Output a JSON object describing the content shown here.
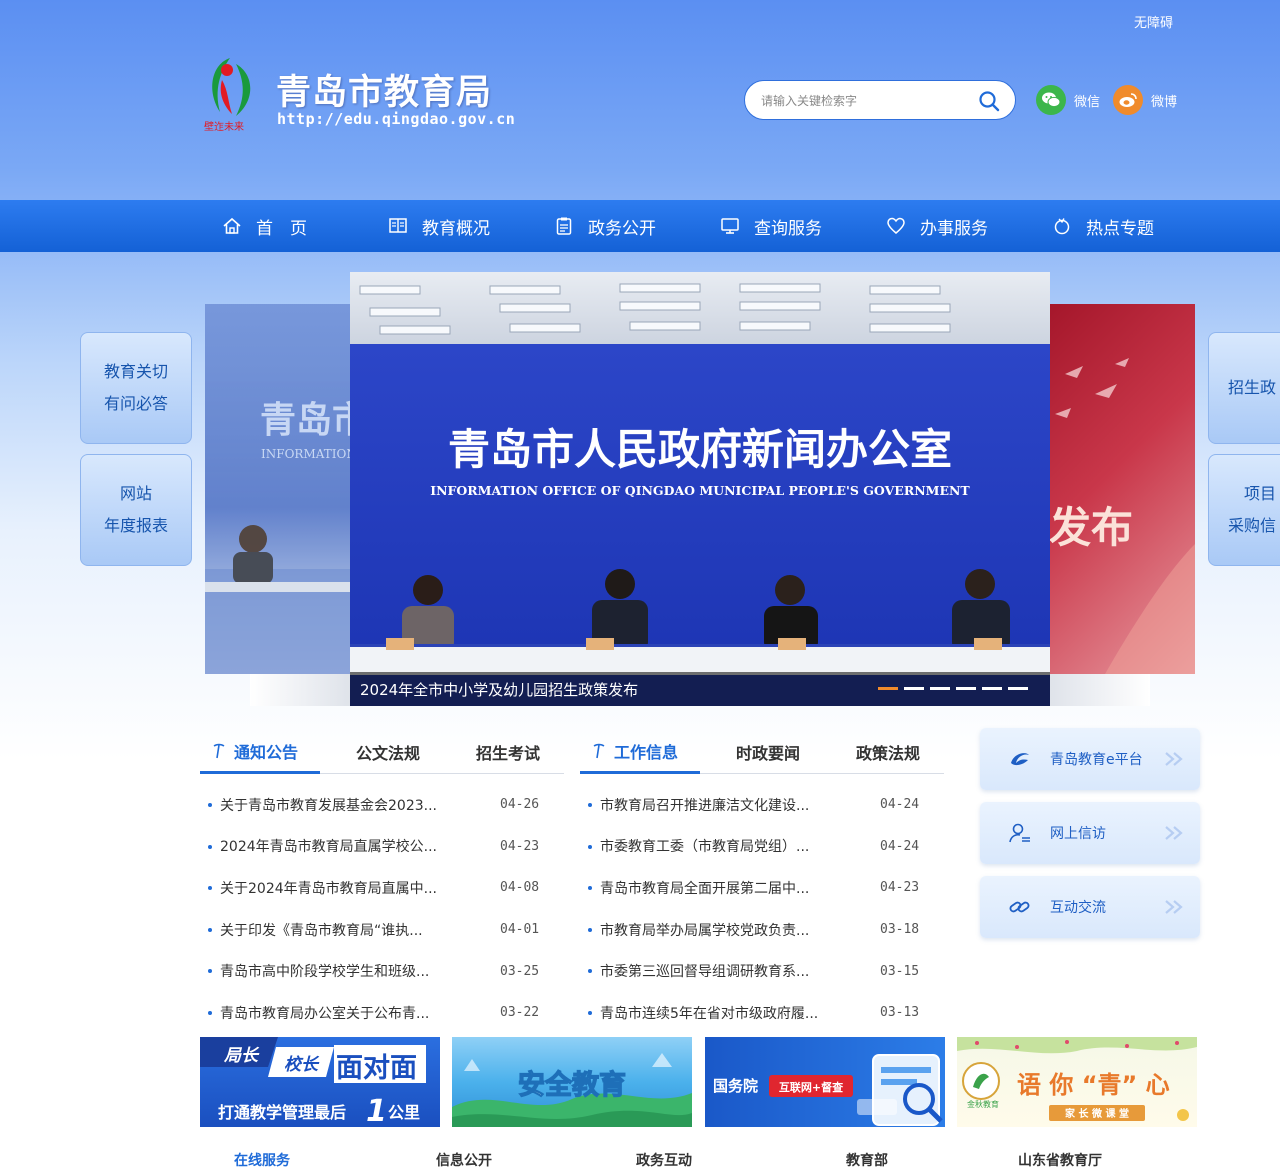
{
  "header": {
    "accessibility": "无障碍",
    "site_title": "青岛市教育局",
    "site_url": "http://edu.qingdao.gov.cn",
    "emblem_caption": "壁迮未来",
    "search_placeholder": "请输入关键检索字",
    "social": [
      {
        "name": "wechat-icon",
        "label": "微信",
        "color": "#3cb64b"
      },
      {
        "name": "weibo-icon",
        "label": "微博",
        "color": "#f08b2c"
      }
    ]
  },
  "nav": {
    "items": [
      {
        "label": "首　页",
        "icon": "home-icon"
      },
      {
        "label": "教育概况",
        "icon": "overview-icon"
      },
      {
        "label": "政务公开",
        "icon": "clipboard-icon"
      },
      {
        "label": "查询服务",
        "icon": "monitor-icon"
      },
      {
        "label": "办事服务",
        "icon": "heart-icon"
      },
      {
        "label": "热点专题",
        "icon": "flame-icon"
      }
    ]
  },
  "side_left": [
    {
      "line1": "教育关切",
      "line2": "有问必答"
    },
    {
      "line1": "网站",
      "line2": "年度报表"
    }
  ],
  "side_right": [
    {
      "line1": "招生政",
      "line2": ""
    },
    {
      "line1": "项目",
      "line2": "采购信"
    }
  ],
  "slider": {
    "screen_title": "青岛市人民政府新闻办公室",
    "screen_subtitle": "INFORMATION OFFICE OF QINGDAO MUNICIPAL PEOPLE'S GOVERNMENT",
    "left_preview_title": "青岛市",
    "left_preview_sub": "INFORMATION",
    "right_preview_text": "发布",
    "caption": "2024年全市中小学及幼儿园招生政策发布",
    "slide_count": 6,
    "active_index": 0
  },
  "news_left": {
    "tabs": [
      "通知公告",
      "公文法规",
      "招生考试"
    ],
    "active_tab": 0,
    "items": [
      {
        "title": "关于青岛市教育发展基金会2023...",
        "date": "04-26"
      },
      {
        "title": "2024年青岛市教育局直属学校公...",
        "date": "04-23"
      },
      {
        "title": "关于2024年青岛市教育局直属中...",
        "date": "04-08"
      },
      {
        "title": "关于印发《青岛市教育局“谁执...",
        "date": "04-01"
      },
      {
        "title": "青岛市高中阶段学校学生和班级...",
        "date": "03-25"
      },
      {
        "title": "青岛市教育局办公室关于公布青...",
        "date": "03-22"
      }
    ]
  },
  "news_right": {
    "tabs": [
      "工作信息",
      "时政要闻",
      "政策法规"
    ],
    "active_tab": 0,
    "items": [
      {
        "title": "市教育局召开推进廉洁文化建设...",
        "date": "04-24"
      },
      {
        "title": "市委教育工委（市教育局党组）...",
        "date": "04-24"
      },
      {
        "title": "青岛市教育局全面开展第二届中...",
        "date": "04-23"
      },
      {
        "title": "市教育局举办局属学校党政负责...",
        "date": "03-18"
      },
      {
        "title": "市委第三巡回督导组调研教育系...",
        "date": "03-15"
      },
      {
        "title": "青岛市连续5年在省对市级政府履...",
        "date": "03-13"
      }
    ]
  },
  "platforms": [
    {
      "label": "青岛教育e平台",
      "icon": "e-platform-icon"
    },
    {
      "label": "网上信访",
      "icon": "user-letter-icon"
    },
    {
      "label": "互动交流",
      "icon": "link-icon"
    }
  ],
  "banners": {
    "b1": {
      "tag1": "局长",
      "tag2": "校长",
      "title": "面对面",
      "sub": "打通教学管理最后",
      "num": "1",
      "unit": "公里"
    },
    "b2": {
      "title": "安全教育"
    },
    "b3": {
      "left": "国务院",
      "badge": "互联网+督查"
    },
    "b4": {
      "title": "语 你 “青” 心",
      "sub": "家 长 微 课 堂",
      "logo": "金秋教育"
    }
  },
  "bottom_tabs": [
    "在线服务",
    "信息公开",
    "政务互动",
    "教育部",
    "山东省教育厅"
  ]
}
